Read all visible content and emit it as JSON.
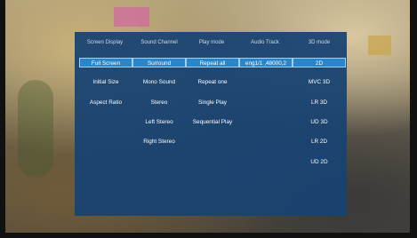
{
  "menu": {
    "columns": [
      {
        "header": "Screen Display",
        "items": [
          "Full Screen",
          "Initial Size",
          "Aspect Ratio"
        ],
        "selected": 0
      },
      {
        "header": "Sound Channel",
        "items": [
          "Surround",
          "Mono Sound",
          "Stereo",
          "Left Stereo",
          "Right Stereo"
        ],
        "selected": 0
      },
      {
        "header": "Play mode",
        "items": [
          "Repeat all",
          "Repeat one",
          "Single Play",
          "Sequential Play"
        ],
        "selected": 0
      },
      {
        "header": "Audio Track",
        "items": [
          "eng1/1 ,48000,2"
        ],
        "selected": 0
      },
      {
        "header": "3D mode",
        "items": [
          "2D",
          "MVC 3D",
          "LR 3D",
          "UD 3D",
          "LR 2D",
          "UD 2D"
        ],
        "selected": 0
      }
    ]
  },
  "colors": {
    "panel": "#174372",
    "selected_item": "#2b85c9",
    "header_text": "#cfd9e6",
    "item_text": "#ffffff"
  }
}
